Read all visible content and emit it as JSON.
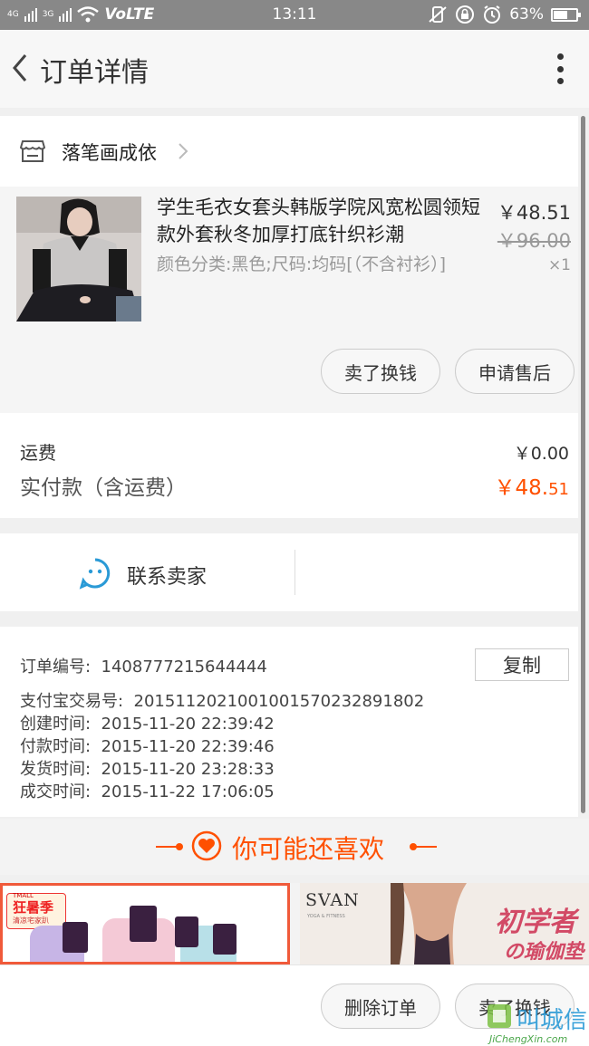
{
  "status_bar": {
    "signal1": "4G",
    "signal2": "3G",
    "volte": "VoLTE",
    "time": "13:11",
    "battery_text": "63%",
    "battery_level": 0.63
  },
  "header": {
    "title": "订单详情"
  },
  "shop": {
    "name": "落笔画成依"
  },
  "product": {
    "title": "学生毛衣女套头韩版学院风宽松圆领短款外套秋冬加厚打底针织衫潮",
    "spec": "颜色分类:黑色;尺码:均码[（不含衬衫）]",
    "price": "￥48.51",
    "original_price": "￥96.00",
    "quantity": "×1",
    "btn_sell": "卖了换钱",
    "btn_aftersale": "申请售后"
  },
  "totals": {
    "shipping_label": "运费",
    "shipping_value": "￥0.00",
    "paid_label": "实付款（含运费）",
    "paid_value_main": "￥48.",
    "paid_value_cents": "51"
  },
  "contact": {
    "label": "联系卖家"
  },
  "order_info": {
    "order_no_label": "订单编号:",
    "order_no": "1408777215644444",
    "copy_label": "复制",
    "alipay_label": "支付宝交易号:",
    "alipay_no": "2015112021001001570232891802",
    "created_label": "创建时间:",
    "created": "2015-11-20 22:39:42",
    "paid_label": "付款时间:",
    "paid": "2015-11-20 22:39:46",
    "shipped_label": "发货时间:",
    "shipped": "2015-11-20 23:28:33",
    "completed_label": "成交时间:",
    "completed": "2015-11-22 17:06:05"
  },
  "recommend": {
    "title": "你可能还喜欢"
  },
  "cards": {
    "card1_top": "TMALL",
    "card1_badge": "狂暑季",
    "card1_sub": "清凉宅家趴",
    "card2_brand": "SVAN",
    "card2_brand_sub": "YOGA & FITNESS",
    "card2_promo1": "初学者",
    "card2_promo2": "の瑜伽垫"
  },
  "footer": {
    "btn_delete": "删除订单",
    "btn_sell": "卖了换钱"
  },
  "watermark": {
    "cn": "叫城信",
    "en": "JiChengXin.com"
  },
  "colors": {
    "accent": "#ff5000",
    "contact_icon": "#2a9ad6"
  }
}
